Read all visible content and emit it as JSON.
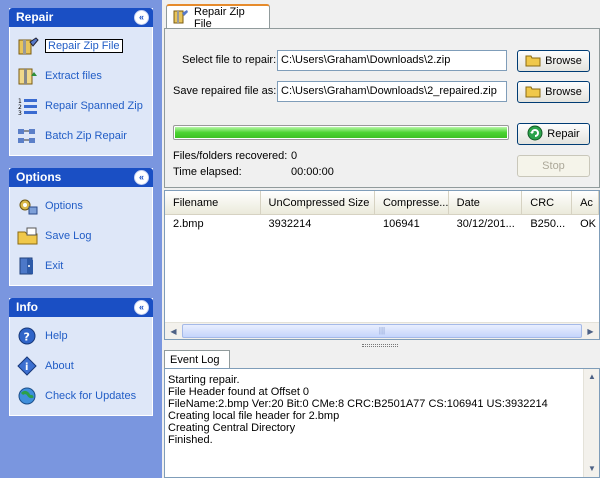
{
  "sidebar": {
    "panels": [
      {
        "title": "Repair",
        "items": [
          {
            "label": "Repair Zip File",
            "icon": "zip-repair-icon"
          },
          {
            "label": "Extract files",
            "icon": "extract-files-icon"
          },
          {
            "label": "Repair Spanned Zip",
            "icon": "spanned-zip-icon"
          },
          {
            "label": "Batch Zip Repair",
            "icon": "batch-repair-icon"
          }
        ]
      },
      {
        "title": "Options",
        "items": [
          {
            "label": "Options",
            "icon": "options-icon"
          },
          {
            "label": "Save Log",
            "icon": "save-log-icon"
          },
          {
            "label": "Exit",
            "icon": "exit-icon"
          }
        ]
      },
      {
        "title": "Info",
        "items": [
          {
            "label": "Help",
            "icon": "help-icon"
          },
          {
            "label": "About",
            "icon": "about-icon"
          },
          {
            "label": "Check for Updates",
            "icon": "updates-icon"
          }
        ]
      }
    ],
    "collapse_glyph": "«"
  },
  "main": {
    "tab_label": "Repair Zip File",
    "select_label": "Select file to repair:",
    "select_value": "C:\\Users\\Graham\\Downloads\\2.zip",
    "save_label": "Save repaired file as:",
    "save_value": "C:\\Users\\Graham\\Downloads\\2_repaired.zip",
    "browse_label": "Browse",
    "repair_label": "Repair",
    "stop_label": "Stop",
    "progress": 1.0,
    "recovered_label": "Files/folders recovered:",
    "recovered_value": "0",
    "elapsed_label": "Time elapsed:",
    "elapsed_value": "00:00:00"
  },
  "table": {
    "columns": [
      "Filename",
      "UnCompressed Size",
      "Compresse...",
      "Date",
      "CRC",
      "Ac"
    ],
    "rows": [
      [
        "2.bmp",
        "3932214",
        "106941",
        "30/12/201...",
        "B250...",
        "OK"
      ]
    ],
    "grip_glyph": "|||"
  },
  "event_log": {
    "tab_label": "Event Log",
    "lines": [
      "Starting repair.",
      "File Header found at Offset 0",
      "FileName:2.bmp Ver:20 Bit:0 CMe:8 CRC:B2501A77 CS:106941 US:3932214",
      "Creating local file header for 2.bmp",
      "Creating Central Directory",
      "Finished."
    ]
  },
  "colors": {
    "sidebar_bg": "#7a96df",
    "panel_header": "#1a4fc4",
    "link": "#215dc6",
    "progress": "#4bd431",
    "tab_accent": "#e68b2c"
  }
}
